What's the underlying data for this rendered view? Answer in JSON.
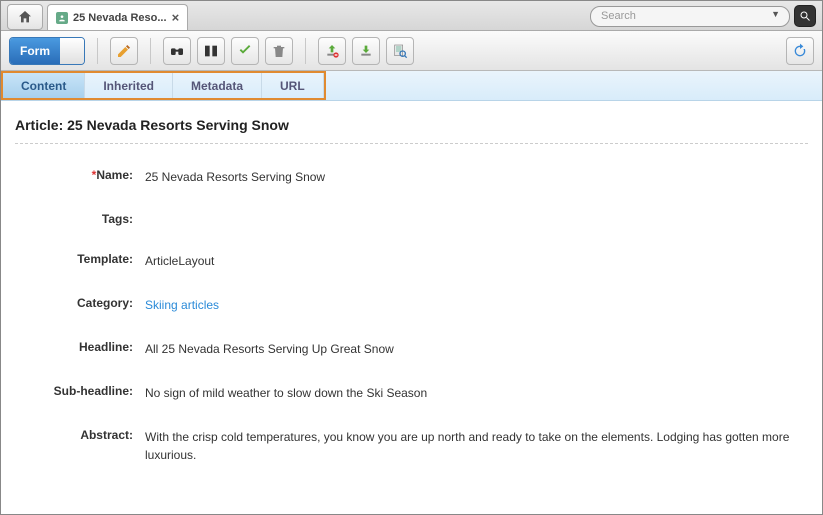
{
  "header": {
    "tab_title": "25 Nevada Reso...",
    "search_placeholder": "Search"
  },
  "toolbar": {
    "form_label": "Form"
  },
  "subtabs": [
    "Content",
    "Inherited",
    "Metadata",
    "URL"
  ],
  "article": {
    "prefix": "Article: ",
    "title": "25 Nevada Resorts Serving Snow"
  },
  "fields": {
    "name": {
      "label": "Name:",
      "value": "25 Nevada Resorts Serving Snow",
      "required": true
    },
    "tags": {
      "label": "Tags:",
      "value": ""
    },
    "template": {
      "label": "Template:",
      "value": "ArticleLayout"
    },
    "category": {
      "label": "Category:",
      "value": "Skiing articles",
      "link": true
    },
    "headline": {
      "label": "Headline:",
      "value": "All 25 Nevada Resorts Serving Up Great Snow"
    },
    "subheadline": {
      "label": "Sub-headline:",
      "value": "No sign of mild weather to slow down the Ski Season"
    },
    "abstract": {
      "label": "Abstract:",
      "value": "With the crisp cold temperatures, you know you are up north and ready to take on the elements. Lodging has gotten more luxurious."
    }
  }
}
